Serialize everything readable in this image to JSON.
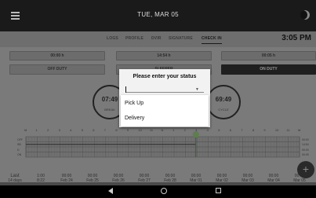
{
  "header": {
    "date": "TUE, MAR 05",
    "time": "3:05 PM"
  },
  "tabs": [
    {
      "label": "LOGS"
    },
    {
      "label": "PROFILE"
    },
    {
      "label": "DVIR"
    },
    {
      "label": "SIGNATURE"
    },
    {
      "label": "CHECK IN"
    }
  ],
  "durations": {
    "off_duty_time": "00:00 h",
    "middle_time": "14:54 h",
    "on_duty_time": "00:05 h"
  },
  "status_buttons": {
    "off_duty": "OFF DUTY",
    "middle": "SLEEPER",
    "on_duty": "ON DUTY"
  },
  "gauges": {
    "break": {
      "value": "07:49",
      "label": "BREAK"
    },
    "cycle": {
      "value": "69:49",
      "label": "CYCLE"
    }
  },
  "log_grid": {
    "hour_labels": [
      "M",
      "1",
      "2",
      "3",
      "4",
      "5",
      "6",
      "7",
      "8",
      "9",
      "10",
      "11",
      "N",
      "1",
      "2",
      "3",
      "4",
      "5",
      "6",
      "7",
      "8",
      "9",
      "10",
      "11",
      "M"
    ],
    "row_labels": [
      "OFF",
      "SB",
      "D",
      "ON"
    ],
    "row_totals": [
      "00:00",
      "14:54",
      "00:00",
      "00:05"
    ]
  },
  "recap": {
    "summary": {
      "top": "Last",
      "bottom": "14 days"
    },
    "days": [
      {
        "top": "1:00",
        "bottom": "8:22"
      },
      {
        "top": "00:00",
        "bottom": "Feb 24"
      },
      {
        "top": "00:00",
        "bottom": "Feb 25"
      },
      {
        "top": "00:00",
        "bottom": "Feb 26"
      },
      {
        "top": "00:00",
        "bottom": "Feb 27"
      },
      {
        "top": "00:00",
        "bottom": "Feb 28"
      },
      {
        "top": "00:00",
        "bottom": "Mar 01"
      },
      {
        "top": "00:00",
        "bottom": "Mar 02"
      },
      {
        "top": "00:00",
        "bottom": "Mar 03"
      },
      {
        "top": "00:00",
        "bottom": "Mar 04"
      },
      {
        "top": "00:00",
        "bottom": "Mar 05"
      }
    ]
  },
  "fab": {
    "label": "+"
  },
  "dialog": {
    "title": "Please enter your status",
    "select_value": "",
    "options": [
      "Pick Up",
      "Delivery"
    ]
  },
  "icons": {
    "menu": "hamburger-icon",
    "theme": "moon-icon",
    "back": "back-icon",
    "home": "home-icon",
    "recent": "recent-apps-icon"
  }
}
